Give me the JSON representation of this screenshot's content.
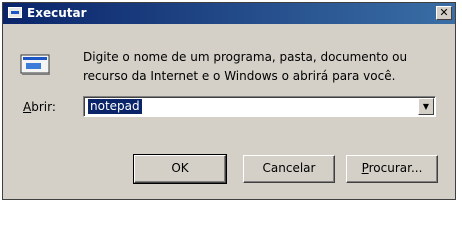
{
  "window": {
    "title": "Executar",
    "close_glyph": "✕"
  },
  "icons": {
    "title_icon": "run-dialog-icon",
    "program_icon": "program-window-icon",
    "dropdown_icon": "chevron-down-icon"
  },
  "description": {
    "line1": "Digite o nome de um programa, pasta, documento ou",
    "line2": "recurso da Internet e o Windows o abrirá para você."
  },
  "open_field": {
    "label_hotkey": "A",
    "label_rest": "brir:",
    "value": "notepad",
    "dropdown_glyph": "▼"
  },
  "buttons": {
    "ok": "OK",
    "cancel": "Cancelar",
    "browse_hotkey": "P",
    "browse_rest": "rocurar..."
  },
  "colors": {
    "titlebar_start": "#0a246a",
    "titlebar_end": "#3a6ea5",
    "dialog_face": "#d4d0c8",
    "selection": "#0a246a"
  }
}
